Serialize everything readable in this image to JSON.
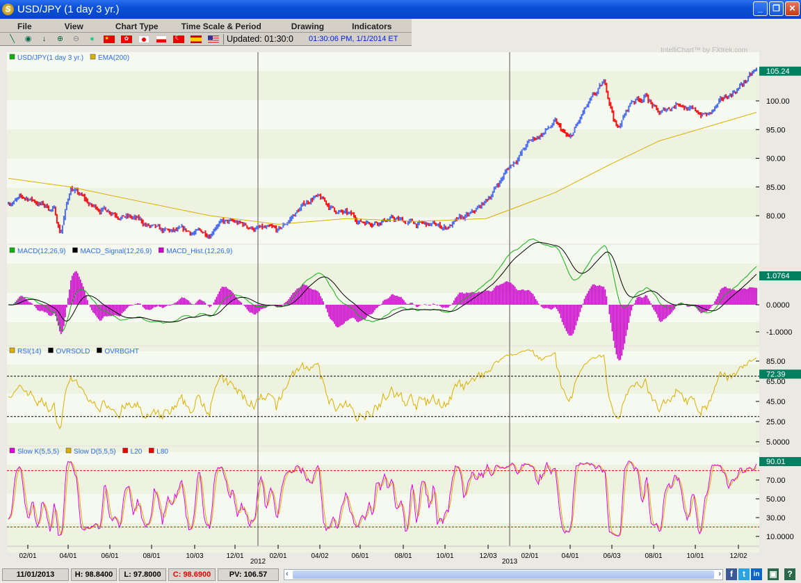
{
  "window": {
    "title": "USD/JPY (1 day  3 yr.)",
    "logo": "S"
  },
  "menu": [
    "File",
    "View",
    "Chart Type",
    "Time Scale & Period",
    "Drawing",
    "Indicators"
  ],
  "toolbar": {
    "icons": [
      "draw-line-icon",
      "crosshair-icon",
      "download-arrow-icon",
      "zoom-in-icon",
      "zoom-out-icon",
      "globe-icon"
    ],
    "flags": [
      "china-flag-icon",
      "hong-kong-flag-icon",
      "japan-flag-icon",
      "poland-flag-icon",
      "turkey-flag-icon",
      "spain-flag-icon",
      "usa-flag-icon"
    ],
    "updated": "Updated: 01:30:0",
    "timestamp": "01:30:06 PM, 1/1/2014 ET"
  },
  "watermark": "IntelliChart™ by FXtrek.com",
  "colors": {
    "up": "#4a6cf0",
    "down": "#ff1010",
    "ema": "#d8b000",
    "macd": "#10b010",
    "signal": "#000000",
    "hist": "#cc00cc",
    "rsi": "#d8b000",
    "slowk": "#dd00dd",
    "slowd": "#d8b000",
    "tag": "#008060"
  },
  "chart_data": {
    "type": "line",
    "time_unit": "months since Jan 2011",
    "x_ticks": [
      "02/01",
      "04/01",
      "06/01",
      "08/01",
      "10/03",
      "12/01",
      "02/01",
      "04/02",
      "06/01",
      "08/01",
      "10/01",
      "12/03",
      "02/01",
      "04/01",
      "06/03",
      "08/01",
      "10/01",
      "12/02"
    ],
    "year_labels": [
      "2012",
      "2013"
    ],
    "panels": [
      {
        "name": "price",
        "legend": [
          "USD/JPY(1 day  3 yr.)",
          "EMA(200)"
        ],
        "yticks": [
          "100.00",
          "95.00",
          "90.00",
          "85.00",
          "80.00"
        ],
        "last": "105.24",
        "price_path": [
          [
            0,
            82.5
          ],
          [
            1,
            83
          ],
          [
            2.2,
            81
          ],
          [
            2.5,
            77
          ],
          [
            3,
            85
          ],
          [
            4,
            81.5
          ],
          [
            5,
            81
          ],
          [
            6.3,
            79
          ],
          [
            7.3,
            77
          ],
          [
            9.7,
            77
          ],
          [
            10,
            79
          ],
          [
            11,
            78.5
          ],
          [
            13,
            77
          ],
          [
            13.7,
            80
          ],
          [
            14.7,
            83.5
          ],
          [
            15.7,
            81
          ],
          [
            17,
            79
          ],
          [
            18.3,
            79.5
          ],
          [
            19.7,
            78.5
          ],
          [
            21,
            78
          ],
          [
            22.3,
            80
          ],
          [
            23,
            82.5
          ],
          [
            24,
            88
          ],
          [
            25,
            92.5
          ],
          [
            26.3,
            96
          ],
          [
            27,
            93
          ],
          [
            27.7,
            98
          ],
          [
            28.7,
            103
          ],
          [
            29.3,
            95
          ],
          [
            30,
            100
          ],
          [
            30.7,
            101
          ],
          [
            31.3,
            97.5
          ],
          [
            32.3,
            100
          ],
          [
            33,
            98
          ],
          [
            33.7,
            97.5
          ],
          [
            34.7,
            101
          ],
          [
            36,
            105.2
          ]
        ],
        "ema_path": [
          [
            0,
            86.5
          ],
          [
            3,
            85
          ],
          [
            6.3,
            82.5
          ],
          [
            9.7,
            80
          ],
          [
            13,
            78.5
          ],
          [
            16.3,
            79.5
          ],
          [
            19.7,
            79
          ],
          [
            23,
            79.5
          ],
          [
            26.3,
            84
          ],
          [
            29,
            89
          ],
          [
            31.3,
            93
          ],
          [
            36,
            98
          ]
        ]
      },
      {
        "name": "macd",
        "legend": [
          "MACD(12,26,9)",
          "MACD_Signal(12,26,9)",
          "MACD_Hist.(12,26,9)"
        ],
        "yticks": [
          "0.0000",
          "-1.0000"
        ],
        "last": "1.0764"
      },
      {
        "name": "rsi",
        "legend": [
          "RSI(14)",
          "OVRSOLD",
          "OVRBGHT"
        ],
        "yticks": [
          "85.00",
          "65.00",
          "45.00",
          "25.00",
          "5.0000"
        ],
        "last": "72.39",
        "oversold": 30,
        "overbought": 70
      },
      {
        "name": "stoch",
        "legend": [
          "Slow K(5,5,5)",
          "Slow D(5,5,5)",
          "L20",
          "L80"
        ],
        "yticks": [
          "70.00",
          "50.00",
          "30.00",
          "10.0000"
        ],
        "last": "90.01",
        "l20": 20,
        "l80": 80
      }
    ]
  },
  "status": {
    "date": "11/01/2013",
    "high": "H: 98.8400",
    "low": "L: 97.8000",
    "close": "C: 98.6900",
    "pv": "PV: 106.57"
  },
  "social": [
    "f",
    "t",
    "in",
    "▣",
    "?"
  ]
}
